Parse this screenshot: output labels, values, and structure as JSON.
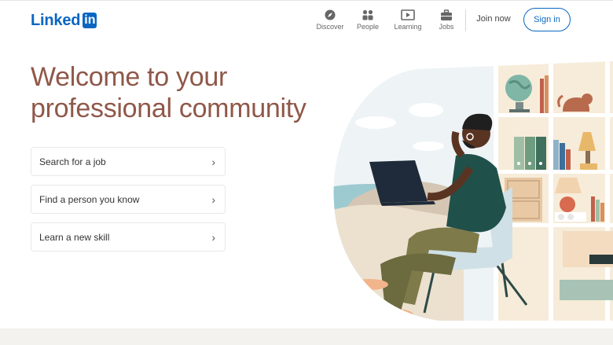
{
  "header": {
    "logo_text": "Linked",
    "logo_box": "in",
    "nav": [
      {
        "label": "Discover",
        "icon": "compass-icon"
      },
      {
        "label": "People",
        "icon": "people-icon"
      },
      {
        "label": "Learning",
        "icon": "video-icon"
      },
      {
        "label": "Jobs",
        "icon": "briefcase-icon"
      }
    ],
    "join_now": "Join now",
    "sign_in": "Sign in"
  },
  "hero": {
    "headline": "Welcome to your professional community",
    "options": [
      {
        "label": "Search for a job"
      },
      {
        "label": "Find a person you know"
      },
      {
        "label": "Learn a new skill"
      }
    ]
  },
  "colors": {
    "brand": "#0a66c2",
    "headline": "#8f5849",
    "footer_band": "#f3f2ef"
  }
}
